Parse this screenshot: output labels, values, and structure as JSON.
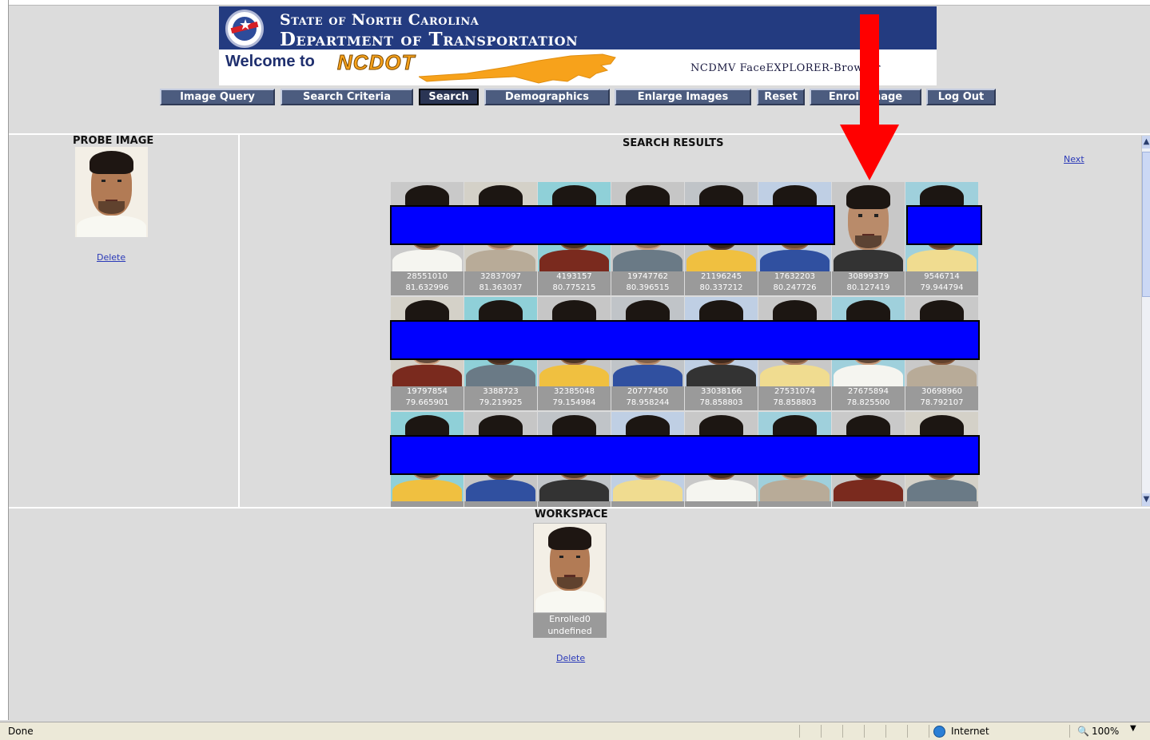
{
  "banner": {
    "state_line": "State of North Carolina",
    "department_line": "Department of Transportation",
    "welcome_text": "Welcome to",
    "ncdot_text": "NCDOT",
    "browser_name": "NCDMV FaceEXPLORER-Browser"
  },
  "nav": [
    {
      "label": "Image Query"
    },
    {
      "label": "Search Criteria"
    },
    {
      "label": "Search",
      "active": true
    },
    {
      "label": "Demographics"
    },
    {
      "label": "Enlarge Images"
    },
    {
      "label": "Reset"
    },
    {
      "label": "Enroll Image"
    },
    {
      "label": "Log Out"
    }
  ],
  "probe": {
    "title": "PROBE IMAGE",
    "delete_label": "Delete"
  },
  "results": {
    "title": "SEARCH RESULTS",
    "next_label": "Next",
    "rows": [
      [
        {
          "id": "28551010",
          "score": "81.632996"
        },
        {
          "id": "32837097",
          "score": "81.363037"
        },
        {
          "id": "4193157",
          "score": "80.775215"
        },
        {
          "id": "19747762",
          "score": "80.396515"
        },
        {
          "id": "21196245",
          "score": "80.337212"
        },
        {
          "id": "17632203",
          "score": "80.247726"
        },
        {
          "id": "30899379",
          "score": "80.127419"
        },
        {
          "id": "9546714",
          "score": "79.944794"
        }
      ],
      [
        {
          "id": "19797854",
          "score": "79.665901"
        },
        {
          "id": "3388723",
          "score": "79.219925"
        },
        {
          "id": "32385048",
          "score": "79.154984"
        },
        {
          "id": "20777450",
          "score": "78.958244"
        },
        {
          "id": "33038166",
          "score": "78.858803"
        },
        {
          "id": "27531074",
          "score": "78.858803"
        },
        {
          "id": "27675894",
          "score": "78.825500"
        },
        {
          "id": "30698960",
          "score": "78.792107"
        }
      ],
      [
        {
          "id": "",
          "score": ""
        },
        {
          "id": "",
          "score": ""
        },
        {
          "id": "",
          "score": ""
        },
        {
          "id": "",
          "score": ""
        },
        {
          "id": "",
          "score": ""
        },
        {
          "id": "",
          "score": ""
        },
        {
          "id": "",
          "score": ""
        },
        {
          "id": "",
          "score": ""
        }
      ]
    ]
  },
  "workspace": {
    "title": "WORKSPACE",
    "caption_line1": "Enrolled0",
    "caption_line2": "undefined",
    "delete_label": "Delete"
  },
  "status": {
    "left_text": "Done",
    "zone": "Internet",
    "zoom": "100%"
  },
  "colors": {
    "banner_blue": "#233b80",
    "nav_button": "#4c5c7f",
    "redaction": "#0000ff",
    "annotation_arrow": "#ff0000",
    "link": "#2a39b8"
  }
}
